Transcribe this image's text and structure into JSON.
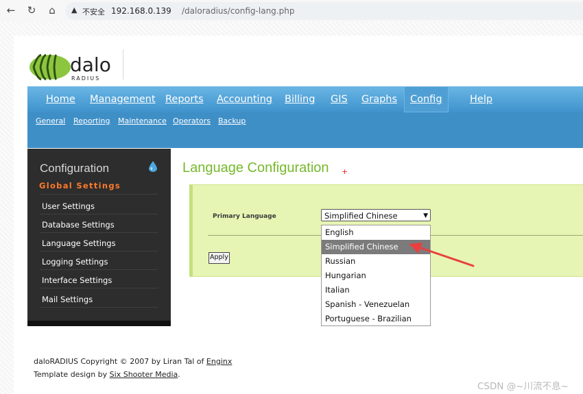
{
  "browser": {
    "insecure_label": "不安全",
    "url_host": "192.168.0.139",
    "url_path": "/daloradius/config-lang.php"
  },
  "logo": {
    "word": "dalo",
    "sub": "RADIUS"
  },
  "menu": {
    "items": [
      "Home",
      "Management",
      "Reports",
      "Accounting",
      "Billing",
      "GIS",
      "Graphs",
      "Config",
      "Help"
    ],
    "active": "Config",
    "sub_items": [
      "General",
      "Reporting",
      "Maintenance",
      "Operators",
      "Backup"
    ]
  },
  "sidebar": {
    "title": "Configuration",
    "subtitle": "Global Settings",
    "items": [
      "User Settings",
      "Database Settings",
      "Language Settings",
      "Logging Settings",
      "Interface Settings",
      "Mail Settings"
    ]
  },
  "content": {
    "title": "Language Configuration",
    "plus": "+",
    "field_label": "Primary Language",
    "selected_value": "Simplified Chinese",
    "apply_label": "Apply",
    "options": [
      "English",
      "Simplified Chinese",
      "Russian",
      "Hungarian",
      "Italian",
      "Spanish - Venezuelan",
      "Portuguese - Brazilian"
    ],
    "highlighted_option": "Simplified Chinese"
  },
  "footer": {
    "copyright_prefix": "daloRADIUS Copyright © 2007 by Liran Tal of ",
    "copyright_link": "Enginx",
    "design_prefix": "Template design by ",
    "design_link": "Six Shooter Media",
    "design_suffix": "."
  },
  "watermark": "CSDN @~川流不息~",
  "colors": {
    "menu_blue": "#3f8fc7",
    "title_green": "#76b82a",
    "sidebar_orange": "#ff7a2a",
    "form_bg": "#e6f5b3",
    "annotation_red": "#e84040"
  },
  "icons": {
    "back": "arrow-left-icon",
    "reload": "reload-icon",
    "home": "home-icon",
    "warning": "warning-icon",
    "drop": "water-drop-icon"
  }
}
